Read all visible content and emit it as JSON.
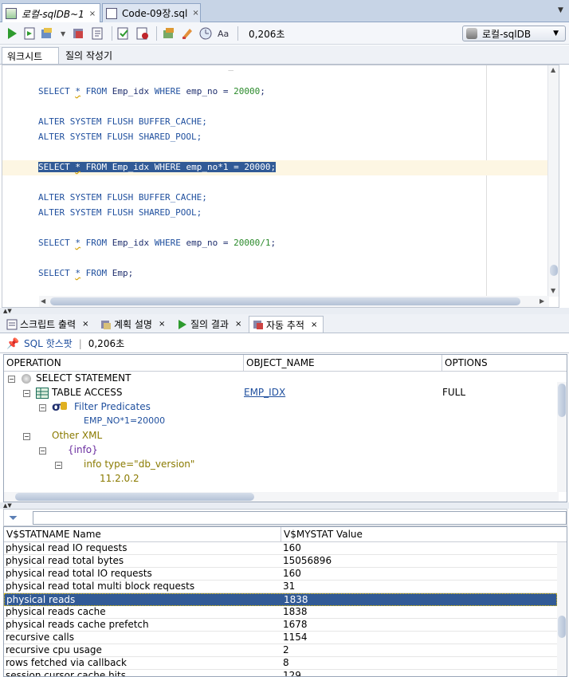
{
  "tabs": [
    {
      "label": "로컬-sqlDB~1",
      "close": "×"
    },
    {
      "label": "Code-09장.sql",
      "close": "×"
    }
  ],
  "tabbar_more": "▼",
  "toolbar": {
    "timing": "0,206초",
    "connection": "로컬-sqlDB",
    "dropdown": "▼"
  },
  "subtabs": [
    "워크시트",
    "질의 작성기"
  ],
  "editor": {
    "partial_top": "                                    _",
    "lines": [
      {
        "kind": "select",
        "a": "SELECT ",
        "star": "*",
        "b": " FROM ",
        "c": "Emp_idx ",
        "d": "WHERE ",
        "e": "emp_no = ",
        "n": "20000",
        "f": ";"
      },
      {
        "kind": "alter",
        "text": "ALTER SYSTEM FLUSH BUFFER_CACHE;"
      },
      {
        "kind": "alter",
        "text": "ALTER SYSTEM FLUSH SHARED_POOL;"
      },
      {
        "kind": "select",
        "a": "SELECT ",
        "star": "*",
        "b": " FROM ",
        "c": "Emp_idx ",
        "d": "WHERE ",
        "e": "emp_no*1 = ",
        "n": "20000",
        "f": ";"
      },
      {
        "kind": "alter",
        "text": "ALTER SYSTEM FLUSH BUFFER_CACHE;"
      },
      {
        "kind": "alter",
        "text": "ALTER SYSTEM FLUSH SHARED_POOL;"
      },
      {
        "kind": "select",
        "a": "SELECT ",
        "star": "*",
        "b": " FROM ",
        "c": "Emp_idx ",
        "d": "WHERE ",
        "e": "emp_no = ",
        "n": "20000/1",
        "f": ";"
      },
      {
        "kind": "select2",
        "a": "SELECT ",
        "star": "*",
        "b": " FROM ",
        "c": "Emp;"
      }
    ],
    "highlighted_line_index": 3
  },
  "result_tabs": [
    {
      "label": "스크립트 출력",
      "close": "×"
    },
    {
      "label": "계획 설명",
      "close": "×"
    },
    {
      "label": "질의 결과",
      "close": "×"
    },
    {
      "label": "자동 추적",
      "close": "×"
    }
  ],
  "hotspot": {
    "link": "SQL 핫스팟",
    "timing": "0,206초"
  },
  "plan": {
    "columns": [
      "OPERATION",
      "OBJECT_NAME",
      "OPTIONS"
    ],
    "rows": [
      {
        "op": "SELECT STATEMENT",
        "obj": "",
        "opt": ""
      },
      {
        "op": "TABLE ACCESS",
        "obj": "EMP_IDX",
        "opt": "FULL"
      },
      {
        "op": "Filter Predicates",
        "obj": "",
        "opt": ""
      },
      {
        "op": "EMP_NO*1=20000",
        "obj": "",
        "opt": ""
      },
      {
        "op": "Other XML",
        "obj": "",
        "opt": ""
      },
      {
        "op": "{info}",
        "obj": "",
        "opt": ""
      },
      {
        "op": "info type=\"db_version\"",
        "obj": "",
        "opt": ""
      },
      {
        "op": "11.2.0.2",
        "obj": "",
        "opt": ""
      }
    ]
  },
  "stats": {
    "columns": [
      "V$STATNAME Name",
      "V$MYSTAT Value"
    ],
    "rows": [
      {
        "name": "physical read IO requests",
        "value": "160"
      },
      {
        "name": "physical read total bytes",
        "value": "15056896"
      },
      {
        "name": "physical read total IO requests",
        "value": "160"
      },
      {
        "name": "physical read total multi block requests",
        "value": "31"
      },
      {
        "name": "physical reads",
        "value": "1838"
      },
      {
        "name": "physical reads cache",
        "value": "1838"
      },
      {
        "name": "physical reads cache prefetch",
        "value": "1678"
      },
      {
        "name": "recursive calls",
        "value": "1154"
      },
      {
        "name": "recursive cpu usage",
        "value": "2"
      },
      {
        "name": "rows fetched via callback",
        "value": "8"
      },
      {
        "name": "session cursor cache hits",
        "value": "129"
      }
    ],
    "selected_index": 4
  },
  "colors": {
    "selection": "#315a96",
    "keyword": "#1f4f9e",
    "number": "#2b8a2b",
    "xml": "#8a7a00"
  }
}
